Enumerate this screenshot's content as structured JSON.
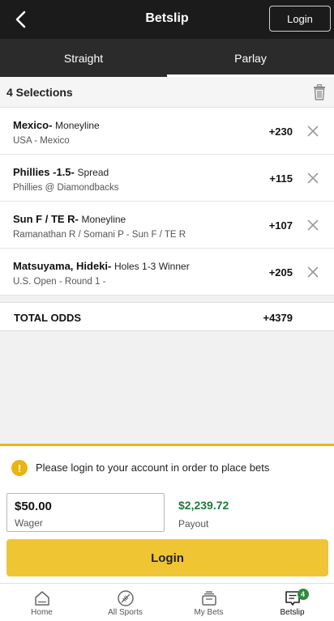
{
  "header": {
    "title": "Betslip",
    "login_label": "Login"
  },
  "tabs": [
    {
      "label": "Straight",
      "active": false
    },
    {
      "label": "Parlay",
      "active": true
    }
  ],
  "selections_header": {
    "count_label": "4 Selections"
  },
  "selections": [
    {
      "name": "Mexico-",
      "market": "Moneyline",
      "event": "USA - Mexico",
      "odds": "+230"
    },
    {
      "name": "Phillies -1.5-",
      "market": "Spread",
      "event": "Phillies @ Diamondbacks",
      "odds": "+115"
    },
    {
      "name": "Sun F / TE R-",
      "market": "Moneyline",
      "event": "Ramanathan R / Somani P - Sun F / TE R",
      "odds": "+107"
    },
    {
      "name": "Matsuyama, Hideki-",
      "market": "Holes 1-3 Winner",
      "event": "U.S. Open - Round 1 -",
      "odds": "+205"
    }
  ],
  "total": {
    "label": "TOTAL ODDS",
    "value": "+4379"
  },
  "bottom_panel": {
    "warning": "Please login to your account in order to place bets",
    "warning_icon": "!",
    "wager_value": "$50.00",
    "wager_label": "Wager",
    "payout_value": "$2,239.72",
    "payout_label": "Payout",
    "login_label": "Login"
  },
  "nav": [
    {
      "label": "Home",
      "icon": "home-icon"
    },
    {
      "label": "All Sports",
      "icon": "football-icon"
    },
    {
      "label": "My Bets",
      "icon": "my-bets-icon"
    },
    {
      "label": "Betslip",
      "icon": "betslip-icon",
      "badge": "4",
      "active": true
    }
  ],
  "colors": {
    "header_bg": "#1b1b1b",
    "accent_yellow": "#f0c534",
    "payout_green": "#1e7a3c",
    "badge_green": "#2e8b3e"
  }
}
